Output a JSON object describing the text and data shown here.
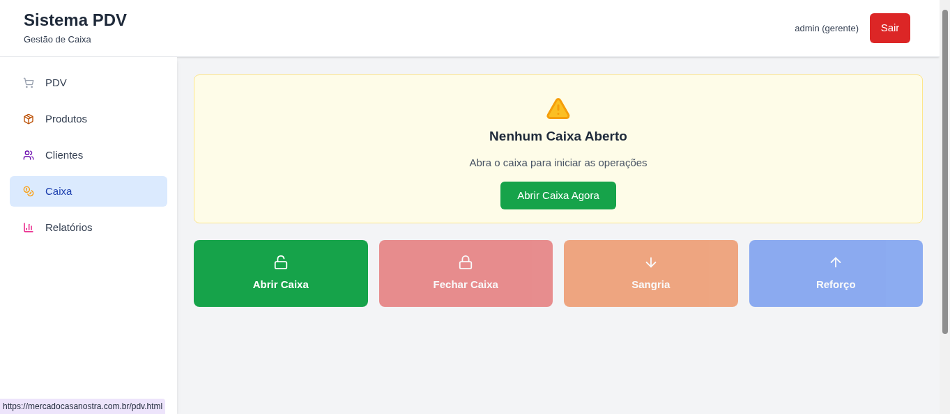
{
  "header": {
    "title": "Sistema PDV",
    "subtitle": "Gestão de Caixa",
    "user": "admin (gerente)",
    "logout": "Sair"
  },
  "sidebar": {
    "items": [
      {
        "label": "PDV",
        "selected": false
      },
      {
        "label": "Produtos",
        "selected": false
      },
      {
        "label": "Clientes",
        "selected": false
      },
      {
        "label": "Caixa",
        "selected": true
      },
      {
        "label": "Relatórios",
        "selected": false
      }
    ]
  },
  "alert": {
    "title": "Nenhum Caixa Aberto",
    "message": "Abra o caixa para iniciar as operações",
    "button": "Abrir Caixa Agora"
  },
  "actions": [
    {
      "label": "Abrir Caixa",
      "disabled": false
    },
    {
      "label": "Fechar Caixa",
      "disabled": true
    },
    {
      "label": "Sangria",
      "disabled": true
    },
    {
      "label": "Reforço",
      "disabled": true
    }
  ],
  "status_url": "https://mercadocasanostra.com.br/pdv.html"
}
